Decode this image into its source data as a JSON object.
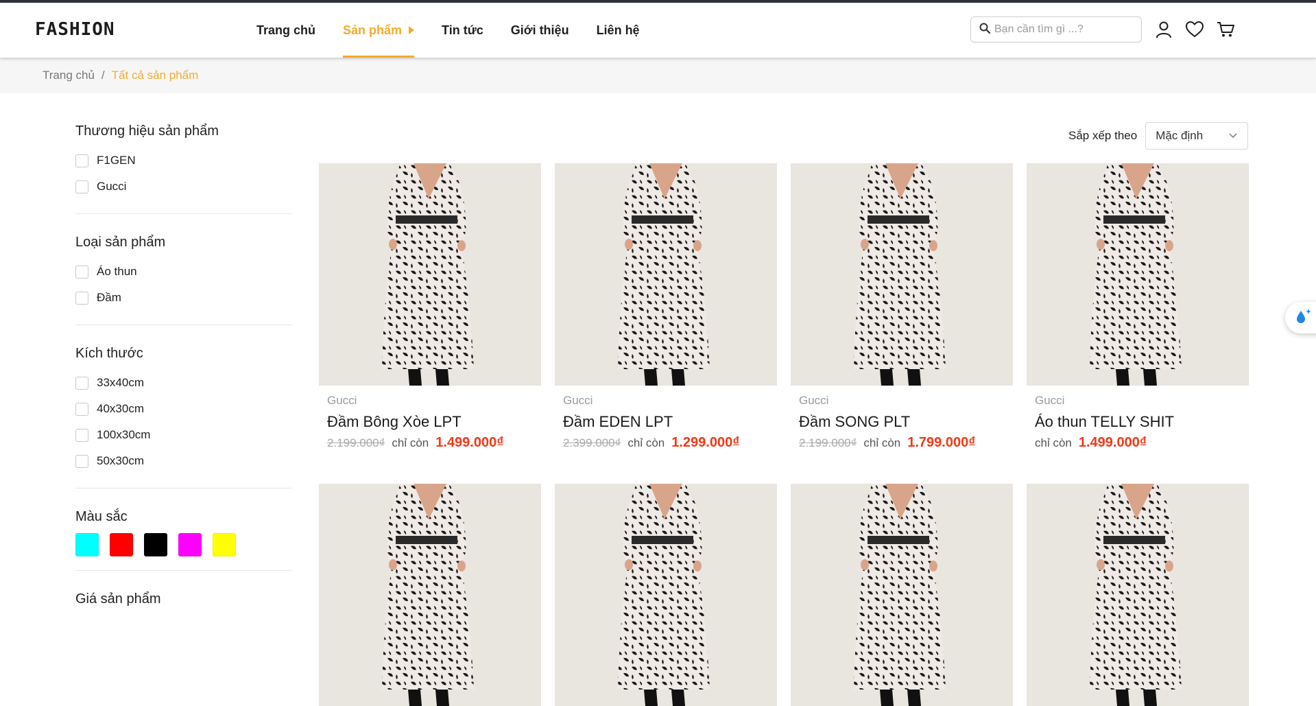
{
  "header": {
    "logo": "FASHION",
    "nav": [
      {
        "label": "Trang chủ",
        "active": false
      },
      {
        "label": "Sản phẩm",
        "active": true
      },
      {
        "label": "Tin tức",
        "active": false
      },
      {
        "label": "Giới thiệu",
        "active": false
      },
      {
        "label": "Liên hệ",
        "active": false
      }
    ],
    "search_placeholder": "Bạn cần tìm gì ...?",
    "icons": [
      "search-icon",
      "user-icon",
      "heart-icon",
      "cart-icon"
    ]
  },
  "breadcrumb": {
    "home": "Trang chủ",
    "separator": "/",
    "current": "Tất cả sản phẩm"
  },
  "filters": {
    "brand": {
      "title": "Thương hiệu sản phẩm",
      "options": [
        "F1GEN",
        "Gucci"
      ]
    },
    "type": {
      "title": "Loại sản phẩm",
      "options": [
        "Áo thun",
        "Đầm"
      ]
    },
    "size": {
      "title": "Kích thước",
      "options": [
        "33x40cm",
        "40x30cm",
        "100x30cm",
        "50x30cm"
      ]
    },
    "color": {
      "title": "Màu sắc",
      "swatches": [
        "#00ffff",
        "#ff0000",
        "#000000",
        "#ff00ff",
        "#ffff00"
      ]
    },
    "price": {
      "title": "Giá sản phẩm"
    }
  },
  "sort": {
    "label": "Sắp xếp theo",
    "value": "Mặc định"
  },
  "products": [
    {
      "brand": "Gucci",
      "name": "Đầm Bông Xòe LPT",
      "old_price": "2.199.000₫",
      "only_label": "chỉ còn",
      "price": "1.499.000₫"
    },
    {
      "brand": "Gucci",
      "name": "Đầm EDEN LPT",
      "old_price": "2.399.000₫",
      "only_label": "chỉ còn",
      "price": "1.299.000₫"
    },
    {
      "brand": "Gucci",
      "name": "Đầm SONG PLT",
      "old_price": "2.199.000₫",
      "only_label": "chỉ còn",
      "price": "1.799.000₫"
    },
    {
      "brand": "Gucci",
      "name": "Áo thun TELLY SHIT",
      "old_price": "",
      "only_label": "chỉ còn",
      "price": "1.499.000₫"
    },
    {
      "brand": "",
      "name": "",
      "old_price": "",
      "only_label": "",
      "price": ""
    },
    {
      "brand": "",
      "name": "",
      "old_price": "",
      "only_label": "",
      "price": ""
    },
    {
      "brand": "",
      "name": "",
      "old_price": "",
      "only_label": "",
      "price": ""
    },
    {
      "brand": "",
      "name": "",
      "old_price": "",
      "only_label": "",
      "price": ""
    }
  ],
  "colors": {
    "accent": "#f2ac2b",
    "sale": "#f03a17",
    "topbar": "#2e2f3e"
  }
}
